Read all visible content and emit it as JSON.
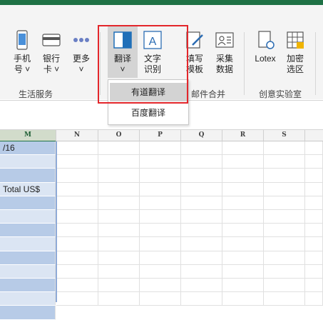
{
  "ribbon": {
    "buttons": {
      "phone": "手机\n号 ˅",
      "bankcard": "银行\n卡 ˅",
      "more": "更多\n˅",
      "translate": "翻译\n˅",
      "ocr": "文字\n识别",
      "fill_template": "填写\n模板",
      "collect_data": "采集\n数据",
      "lotex": "Lotex",
      "encrypt": "加密\n选区"
    },
    "groups": {
      "life_services": "生活服务",
      "mail_merge": "邮件合并",
      "creative_lab": "创意实验室"
    }
  },
  "translate_menu": {
    "items": [
      "有道翻译",
      "百度翻译"
    ]
  },
  "sheet": {
    "columns": [
      "M",
      "N",
      "O",
      "P",
      "Q",
      "R",
      "S"
    ],
    "m_cells": [
      "/16",
      "",
      "",
      "Total US$",
      "",
      "",
      "",
      "",
      "",
      "",
      "",
      "",
      ""
    ]
  },
  "colors": {
    "accent": "#1e7145",
    "highlight_border": "#e3262b",
    "selection_fill": "#b7cbe7"
  }
}
